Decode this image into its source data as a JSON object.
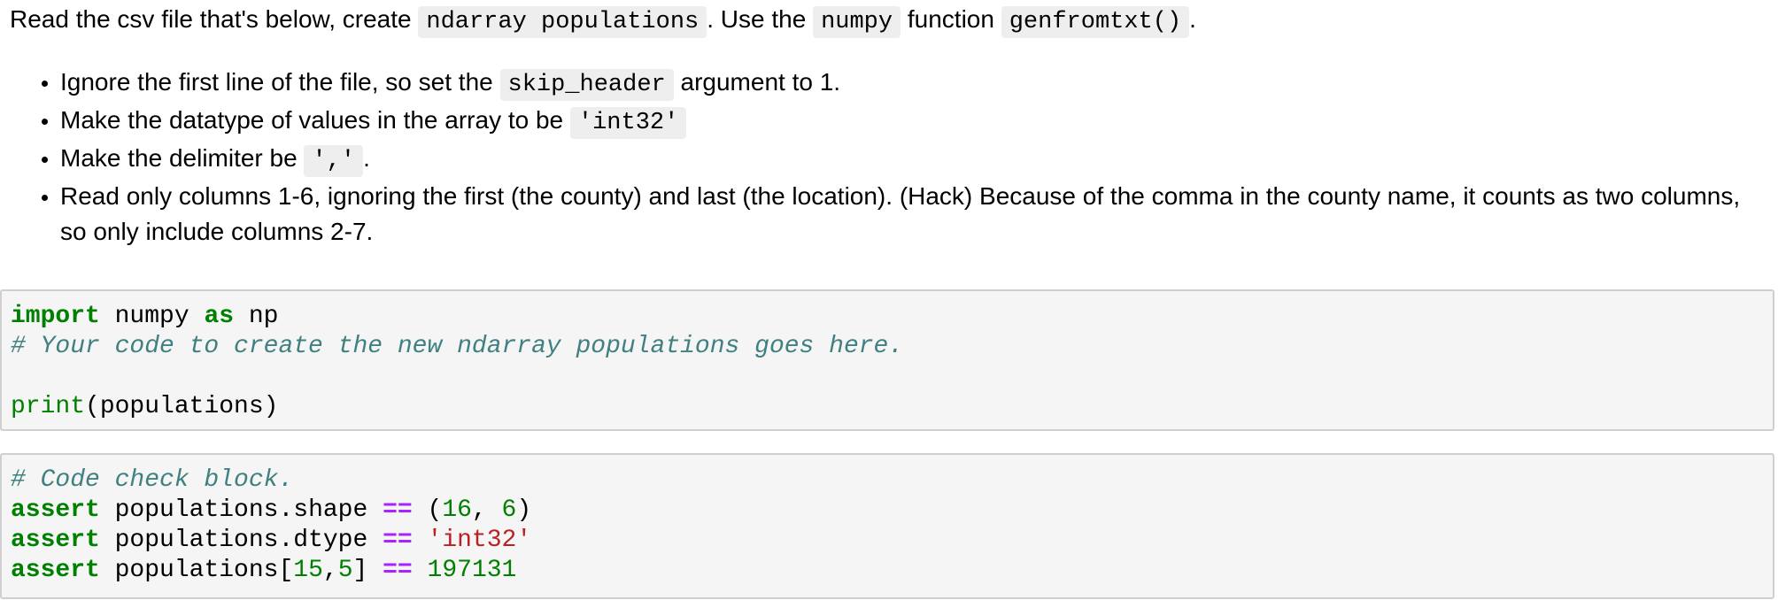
{
  "intro": {
    "t1": "Read the csv file that's below, create ",
    "c1": "ndarray populations",
    "t2": ". Use the ",
    "c2": "numpy",
    "t3": " function ",
    "c3": "genfromtxt()",
    "t4": "."
  },
  "bullets": {
    "b1": {
      "t1": "Ignore the first line of the file, so set the ",
      "c1": "skip_header",
      "t2": " argument to 1."
    },
    "b2": {
      "t1": "Make the datatype of values in the array to be ",
      "c1": "'int32'"
    },
    "b3": {
      "t1": "Make the delimiter be ",
      "c1": "','",
      "t2": "."
    },
    "b4": {
      "t1": "Read only columns 1-6, ignoring the first (the county) and last (the location). (Hack) Because of the comma in the county name, it counts as two columns, so only include columns 2-7."
    }
  },
  "cell1": {
    "kw_import": "import",
    "module": " numpy ",
    "kw_as": "as",
    "alias": " np",
    "comment": "# Your code to create the new ndarray populations goes here.",
    "print_fn": "print",
    "print_args": "(populations)"
  },
  "cell2": {
    "comment": "# Code check block.",
    "kw_assert": "assert",
    "line1": {
      "expr": " populations.shape ",
      "op": "==",
      "open": " (",
      "n1": "16",
      "sep": ", ",
      "n2": "6",
      "close": ")"
    },
    "line2": {
      "expr": " populations.dtype ",
      "op": "==",
      "sp": " ",
      "str": "'int32'"
    },
    "line3": {
      "expr": " populations[",
      "n1": "15",
      "sep": ",",
      "n2": "5",
      "close": "] ",
      "op": "==",
      "sp": " ",
      "n3": "197131"
    }
  }
}
